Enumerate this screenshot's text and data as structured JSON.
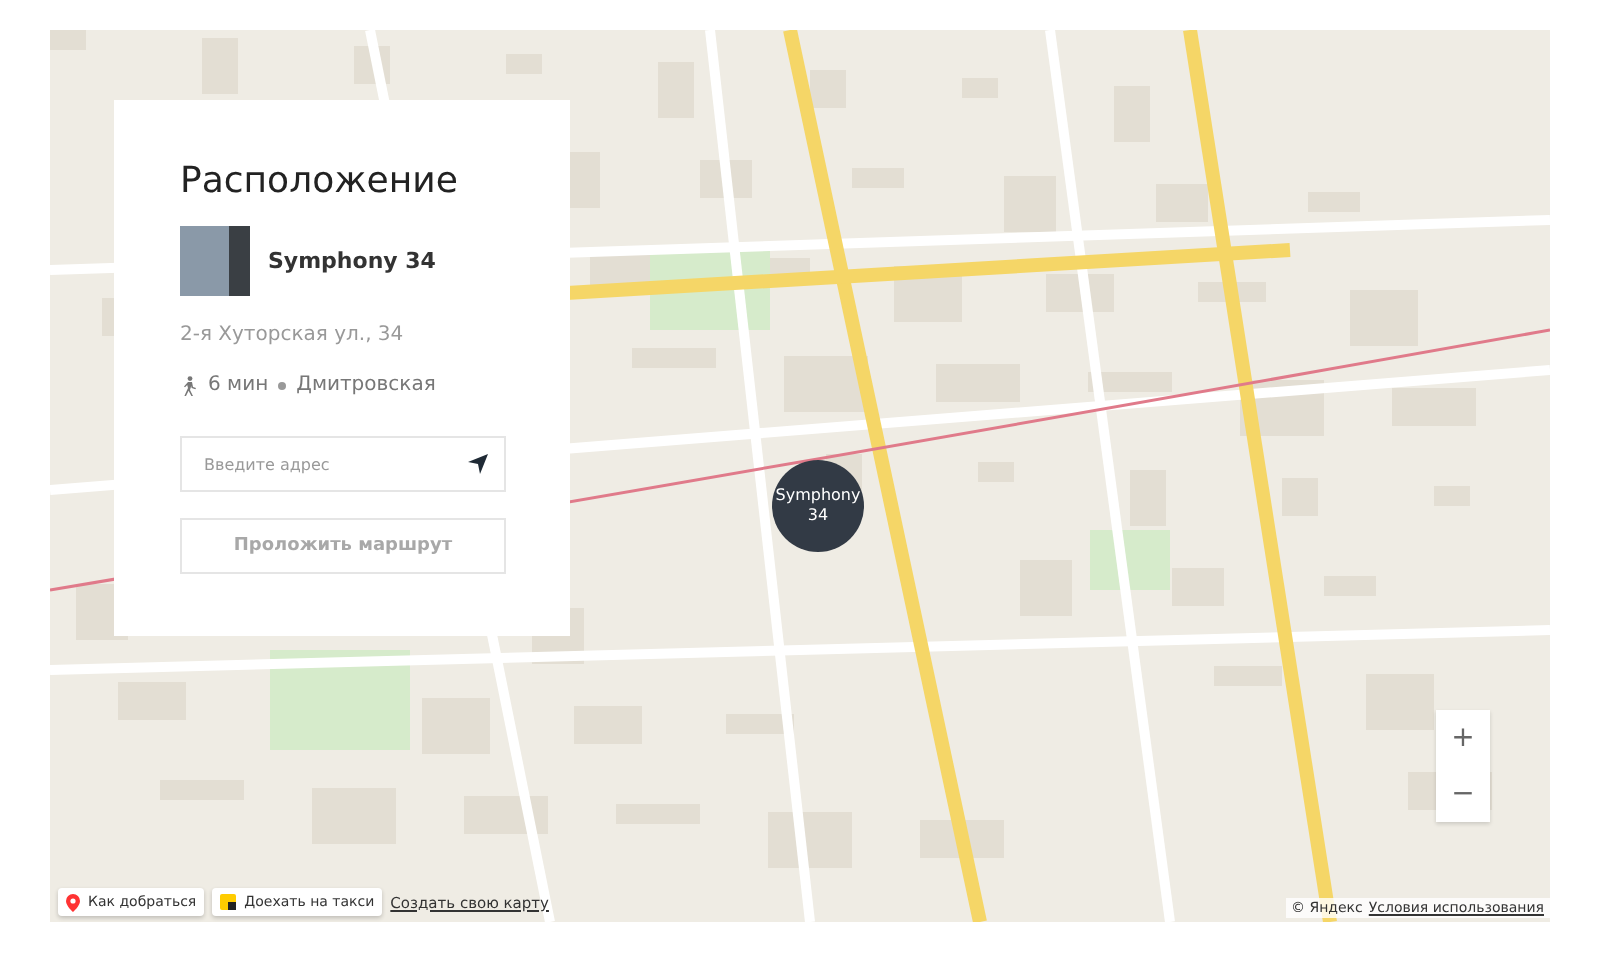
{
  "location_card": {
    "title": "Расположение",
    "property": {
      "name": "Symphony 34"
    },
    "address": "2-я Хуторская ул., 34",
    "transit": {
      "time": "6 мин",
      "station": "Дмитровская"
    },
    "address_field": {
      "placeholder": "Введите адрес"
    },
    "route_button": {
      "label": "Проложить маршрут",
      "disabled": true
    }
  },
  "map": {
    "marker": {
      "label": "Symphony 34"
    },
    "zoom_controls": [
      "+",
      "−"
    ],
    "bottom_left": [
      {
        "kind": "button",
        "label": "Как добраться"
      },
      {
        "kind": "button",
        "label": "Доехать на такси"
      },
      {
        "kind": "link",
        "label": "Создать свою карту"
      }
    ],
    "attribution": {
      "copyright": "© Яндекс",
      "terms_link": "Условия использования"
    }
  }
}
